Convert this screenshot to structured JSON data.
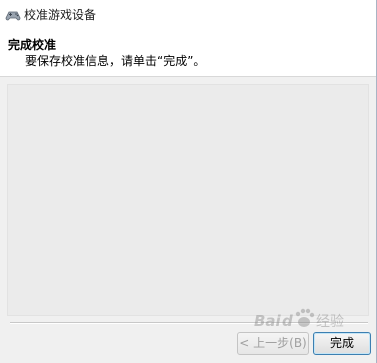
{
  "window": {
    "title": "校准游戏设备",
    "icon": "game-controller-icon"
  },
  "header": {
    "title": "完成校准",
    "description": "要保存校准信息，请单击“完成”。"
  },
  "buttons": {
    "back_label": "< 上一步(B)",
    "finish_label": "完成"
  },
  "watermark": {
    "text": "Baidu 经验",
    "icon": "baidu-paw-icon"
  },
  "colors": {
    "window_bg": "#f0f0f0",
    "header_bg": "#ffffff",
    "content_bg": "#ebebeb",
    "default_button_border": "#3c7fb1"
  }
}
